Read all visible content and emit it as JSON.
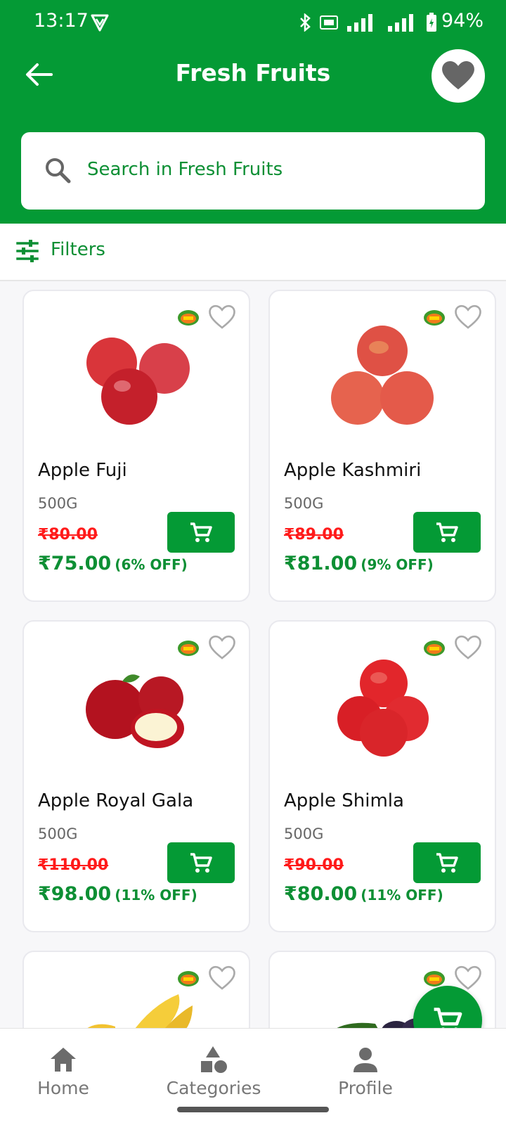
{
  "status_bar": {
    "time": "13:17",
    "battery": "94%"
  },
  "header": {
    "title": "Fresh Fruits"
  },
  "search": {
    "placeholder": "Search in Fresh Fruits"
  },
  "filters": {
    "label": "Filters"
  },
  "products": [
    {
      "name": "Apple Fuji",
      "qty": "500G",
      "mrp": "₹80.00",
      "price": "₹75.00",
      "off": "(6% OFF)"
    },
    {
      "name": "Apple Kashmiri",
      "qty": "500G",
      "mrp": "₹89.00",
      "price": "₹81.00",
      "off": "(9% OFF)"
    },
    {
      "name": "Apple Royal Gala",
      "qty": "500G",
      "mrp": "₹110.00",
      "price": "₹98.00",
      "off": "(11% OFF)"
    },
    {
      "name": "Apple Shimla",
      "qty": "500G",
      "mrp": "₹90.00",
      "price": "₹80.00",
      "off": "(11% OFF)"
    }
  ],
  "bottom_nav": [
    {
      "label": "Home",
      "icon": "home-icon"
    },
    {
      "label": "Categories",
      "icon": "categories-icon"
    },
    {
      "label": "Profile",
      "icon": "profile-icon"
    }
  ],
  "icons": {
    "back": "arrow-left-icon",
    "favorite": "heart-icon",
    "search": "search-icon",
    "filter": "sliders-icon",
    "cart": "cart-icon",
    "brand": "fresh-badge-icon"
  },
  "colors": {
    "brand_green": "#049a35",
    "text_green": "#0d8f34",
    "mrp_red": "#ff1a1a"
  }
}
